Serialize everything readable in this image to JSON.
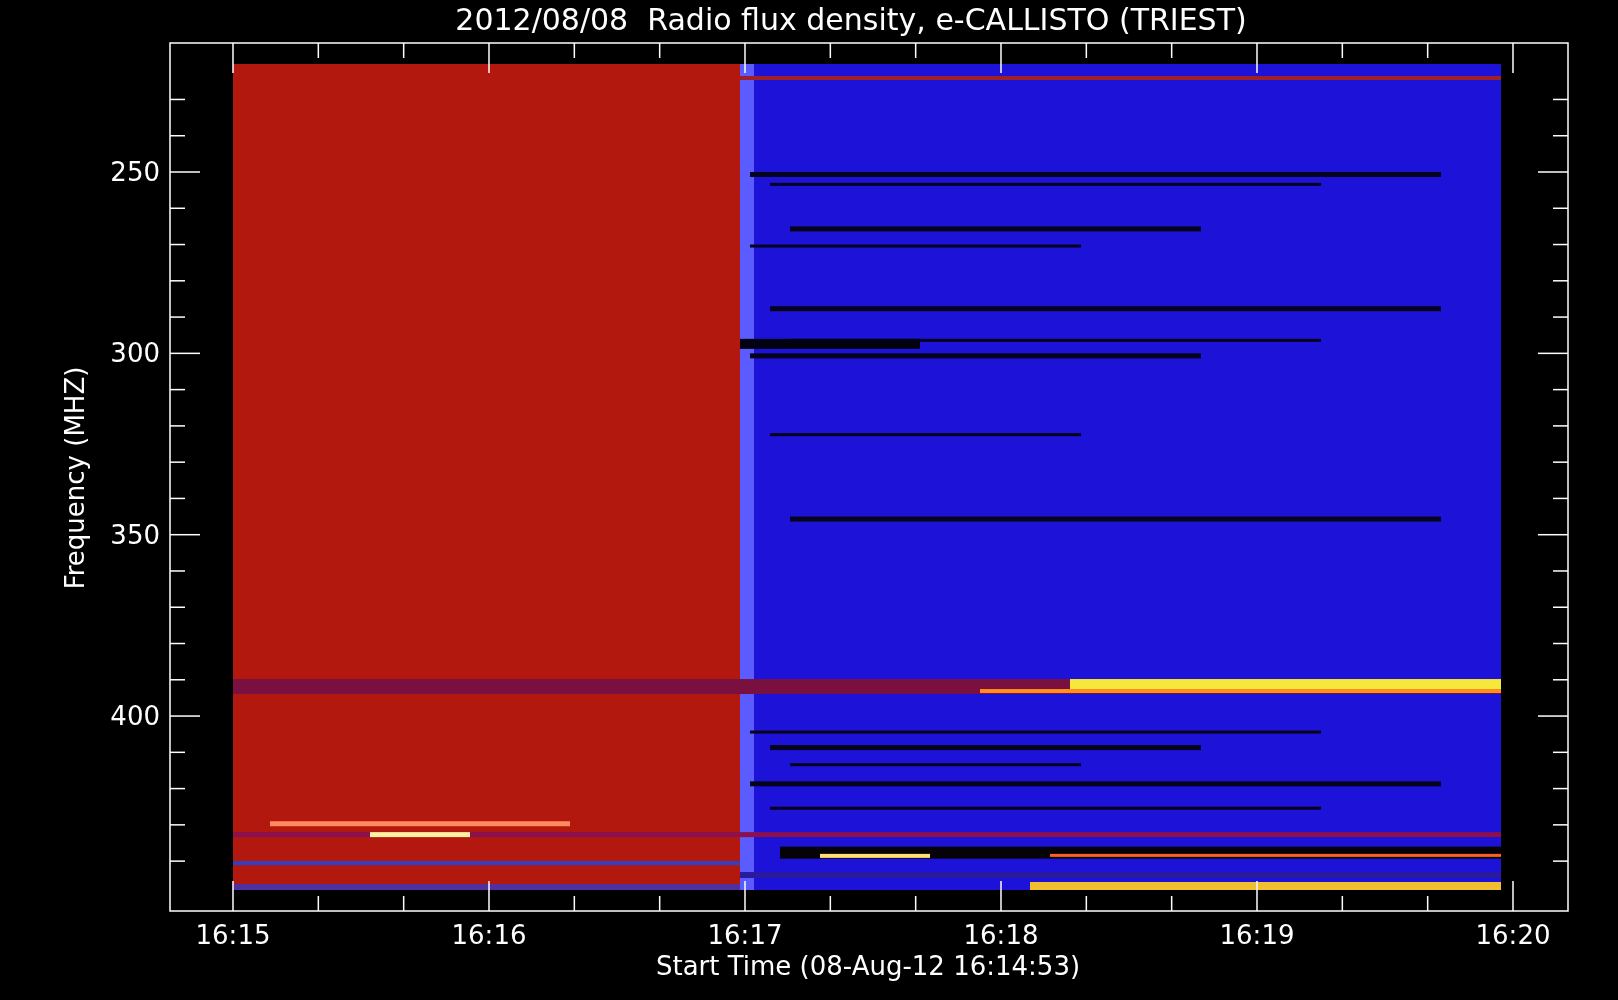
{
  "title": "2012/08/08  Radio flux density, e-CALLISTO (TRIEST)",
  "ylabel": "Frequency (MHZ)",
  "xlabel": "Start Time (08-Aug-12 16:14:53)",
  "yticks": [
    "250",
    "300",
    "350",
    "400"
  ],
  "xticks": [
    "16:15",
    "16:16",
    "16:17",
    "16:18",
    "16:19",
    "16:20"
  ]
}
